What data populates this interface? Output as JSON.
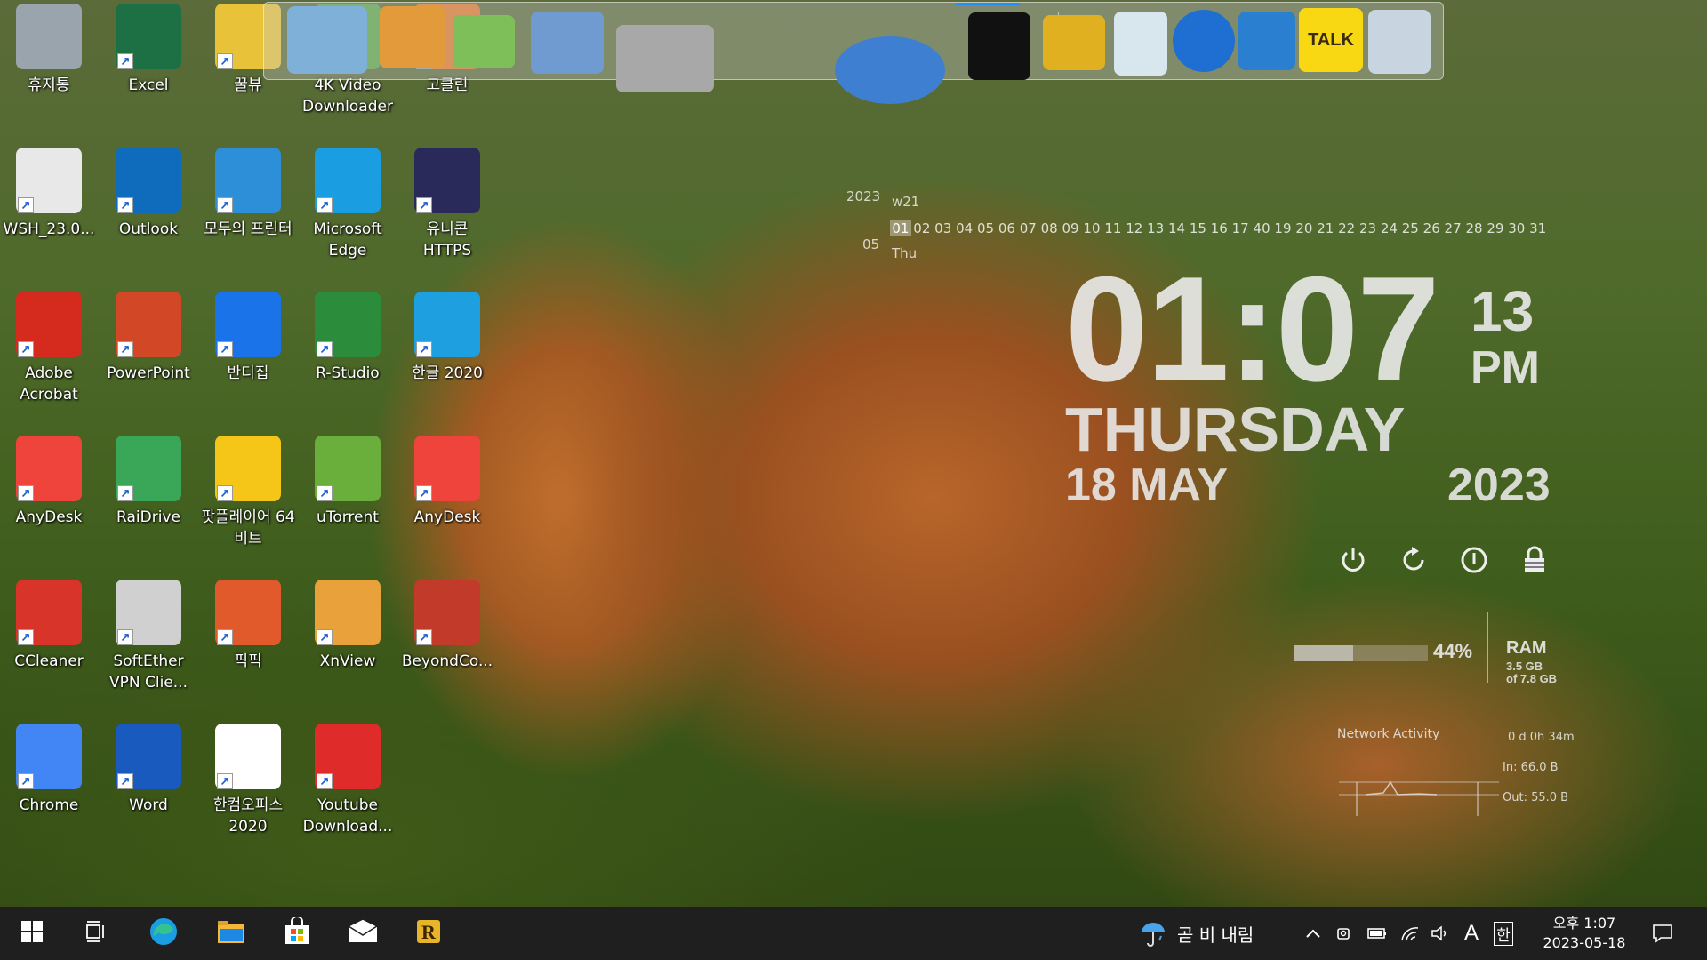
{
  "desktop_icons": [
    {
      "label": "휴지통",
      "icon": "recycle-bin-icon",
      "color": "#9aa4ad"
    },
    {
      "label": "Excel",
      "icon": "excel-icon",
      "color": "#1d7044"
    },
    {
      "label": "꿀뷰",
      "icon": "honeyview-icon",
      "color": "#e8c33a"
    },
    {
      "label": "4K Video Downloader",
      "icon": "4k-video-downloader-icon",
      "color": "#5aa845"
    },
    {
      "label": "고클린",
      "icon": "goclean-icon",
      "color": "#e07a2a"
    },
    {
      "label": "WSH_23.0...",
      "icon": "wsh-file-icon",
      "color": "#e8e8e8"
    },
    {
      "label": "Outlook",
      "icon": "outlook-icon",
      "color": "#0f6cbd"
    },
    {
      "label": "모두의 프린터",
      "icon": "printer-icon",
      "color": "#2c8fd8"
    },
    {
      "label": "Microsoft Edge",
      "icon": "edge-icon",
      "color": "#1b9de2"
    },
    {
      "label": "유니콘 HTTPS",
      "icon": "unicorn-https-icon",
      "color": "#2a2a5a"
    },
    {
      "label": "Adobe Acrobat",
      "icon": "acrobat-icon",
      "color": "#d52b1e"
    },
    {
      "label": "PowerPoint",
      "icon": "powerpoint-icon",
      "color": "#d24726"
    },
    {
      "label": "반디집",
      "icon": "bandizip-icon",
      "color": "#1a73e8"
    },
    {
      "label": "R-Studio",
      "icon": "r-studio-icon",
      "color": "#2b8c3c"
    },
    {
      "label": "한글 2020",
      "icon": "hangul-icon",
      "color": "#1ea0e0"
    },
    {
      "label": "AnyDesk",
      "icon": "anydesk-icon",
      "color": "#ef443b"
    },
    {
      "label": "RaiDrive",
      "icon": "raidrive-icon",
      "color": "#3aa657"
    },
    {
      "label": "팟플레이어 64 비트",
      "icon": "potplayer-icon",
      "color": "#f5c518"
    },
    {
      "label": "uTorrent",
      "icon": "utorrent-icon",
      "color": "#6aae3c"
    },
    {
      "label": "AnyDesk",
      "icon": "anydesk-icon",
      "color": "#ef443b"
    },
    {
      "label": "CCleaner",
      "icon": "ccleaner-icon",
      "color": "#d8342a"
    },
    {
      "label": "SoftEther VPN Clie...",
      "icon": "softether-icon",
      "color": "#d0d0d0"
    },
    {
      "label": "픽픽",
      "icon": "picpick-icon",
      "color": "#e05a2b"
    },
    {
      "label": "XnView",
      "icon": "xnview-icon",
      "color": "#e9a13b"
    },
    {
      "label": "BeyondCo...",
      "icon": "beyond-compare-icon",
      "color": "#c23a2a"
    },
    {
      "label": "Chrome",
      "icon": "chrome-icon",
      "color": "#4285f4"
    },
    {
      "label": "Word",
      "icon": "word-icon",
      "color": "#185abd"
    },
    {
      "label": "한컴오피스 2020",
      "icon": "hancom-office-icon",
      "color": "#ffffff"
    },
    {
      "label": "Youtube Download...",
      "icon": "youtube-downloader-icon",
      "color": "#e02b2b"
    }
  ],
  "dock_items": [
    {
      "icon": "monitor-globe-icon"
    },
    {
      "icon": "folder-orange-icon"
    },
    {
      "icon": "folder-green-icon"
    },
    {
      "icon": "folder-blue-icon"
    },
    {
      "icon": "tools-icon"
    },
    {
      "icon": "globe-icon"
    },
    {
      "icon": "tshirt-icon"
    },
    {
      "icon": "hammer-icon"
    },
    {
      "icon": "trash-can-icon"
    },
    {
      "icon": "moon-icon"
    },
    {
      "icon": "shield-icon"
    },
    {
      "icon": "kakaotalk-icon",
      "label": "TALK"
    },
    {
      "icon": "r-app-icon"
    }
  ],
  "calendar": {
    "year": "2023",
    "week": "w21",
    "month": "05",
    "weekday_short": "Thu",
    "days": [
      "01",
      "02",
      "03",
      "04",
      "05",
      "06",
      "07",
      "08",
      "09",
      "10",
      "11",
      "12",
      "13",
      "14",
      "15",
      "16",
      "17",
      "40",
      "19",
      "20",
      "21",
      "22",
      "23",
      "24",
      "25",
      "26",
      "27",
      "28",
      "29",
      "30",
      "31"
    ],
    "today": "01"
  },
  "clock": {
    "time": "01:07",
    "seconds": "13",
    "ampm": "PM",
    "weekday": "THURSDAY",
    "date": "18 MAY",
    "year": "2023"
  },
  "power_buttons": [
    {
      "icon": "power-icon"
    },
    {
      "icon": "restart-icon"
    },
    {
      "icon": "info-icon"
    },
    {
      "icon": "lock-icon"
    }
  ],
  "ram": {
    "percent": 0.44,
    "percent_label": "44%",
    "title": "RAM",
    "used": "3.5 GB",
    "total": "of 7.8 GB"
  },
  "network": {
    "title": "Network Activity",
    "uptime": "0 d 0h 34m",
    "in": "In: 66.0 B",
    "out": "Out: 55.0 B"
  },
  "taskbar": {
    "apps": [
      {
        "icon": "windows-start-icon"
      },
      {
        "icon": "task-view-icon"
      },
      {
        "icon": "edge-icon"
      },
      {
        "icon": "file-explorer-icon"
      },
      {
        "icon": "microsoft-store-icon"
      },
      {
        "icon": "mail-icon"
      },
      {
        "icon": "r-app-icon"
      }
    ],
    "weather_text": "곧 비 내림",
    "tray_ime_letter": "A",
    "tray_ime_korean": "한",
    "clock_time": "오후 1:07",
    "clock_date": "2023-05-18"
  }
}
